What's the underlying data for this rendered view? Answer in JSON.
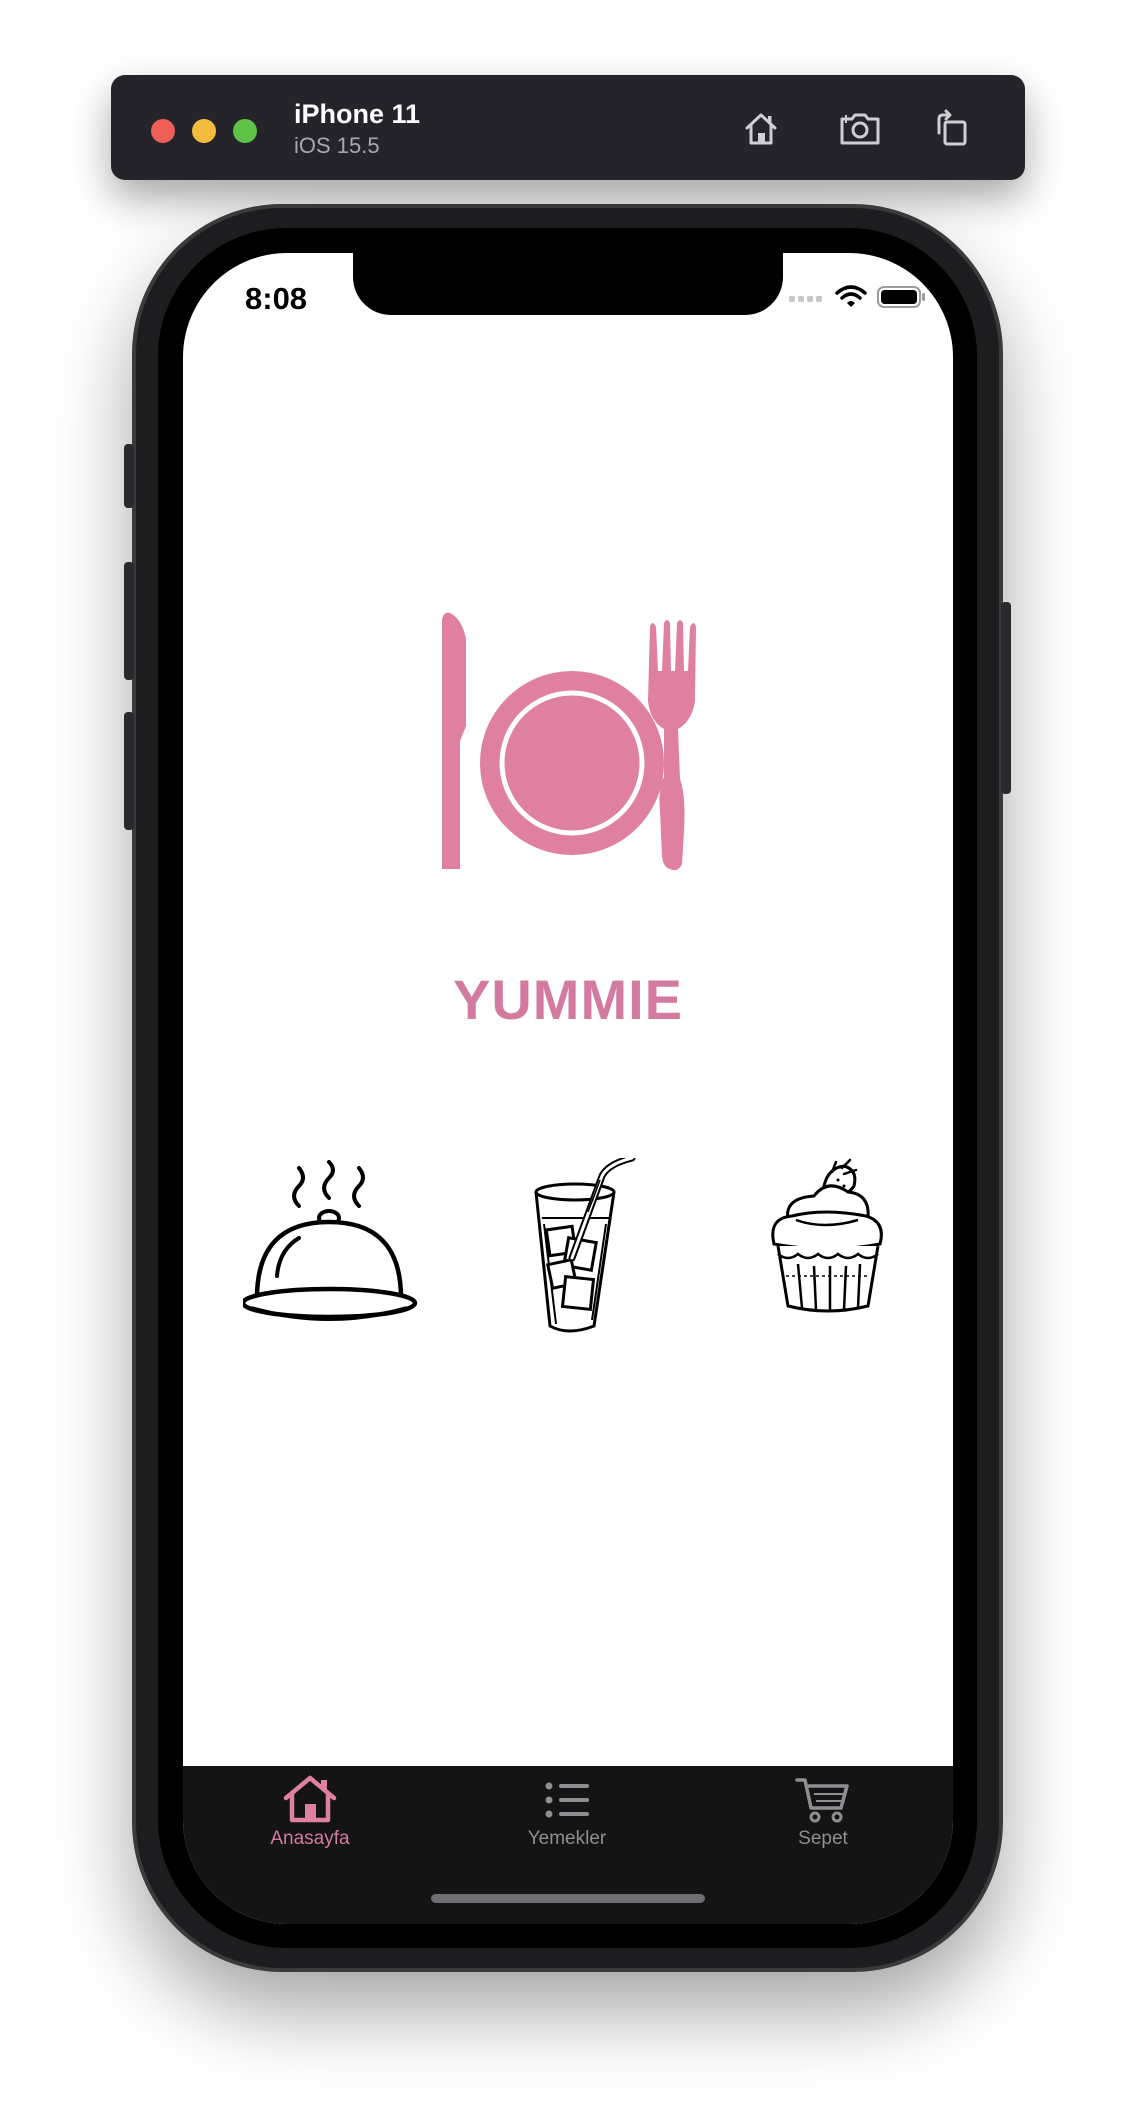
{
  "simulator": {
    "device_name": "iPhone 11",
    "os_version": "iOS 15.5",
    "icons": [
      "home-icon",
      "screenshot-icon",
      "rotate-icon"
    ]
  },
  "status_bar": {
    "time": "8:08",
    "icons": [
      "cellular-icon",
      "wifi-icon",
      "battery-icon"
    ]
  },
  "app": {
    "title": "YUMMIE",
    "accent_color": "#d27aa0",
    "logo_icon": "plate-knife-fork-icon",
    "categories": [
      {
        "icon": "food-cloche-icon"
      },
      {
        "icon": "drink-glass-icon"
      },
      {
        "icon": "cupcake-icon"
      }
    ]
  },
  "tabbar": {
    "active_index": 0,
    "items": [
      {
        "label": "Anasayfa",
        "icon": "house-icon"
      },
      {
        "label": "Yemekler",
        "icon": "list-icon"
      },
      {
        "label": "Sepet",
        "icon": "cart-icon"
      }
    ]
  }
}
